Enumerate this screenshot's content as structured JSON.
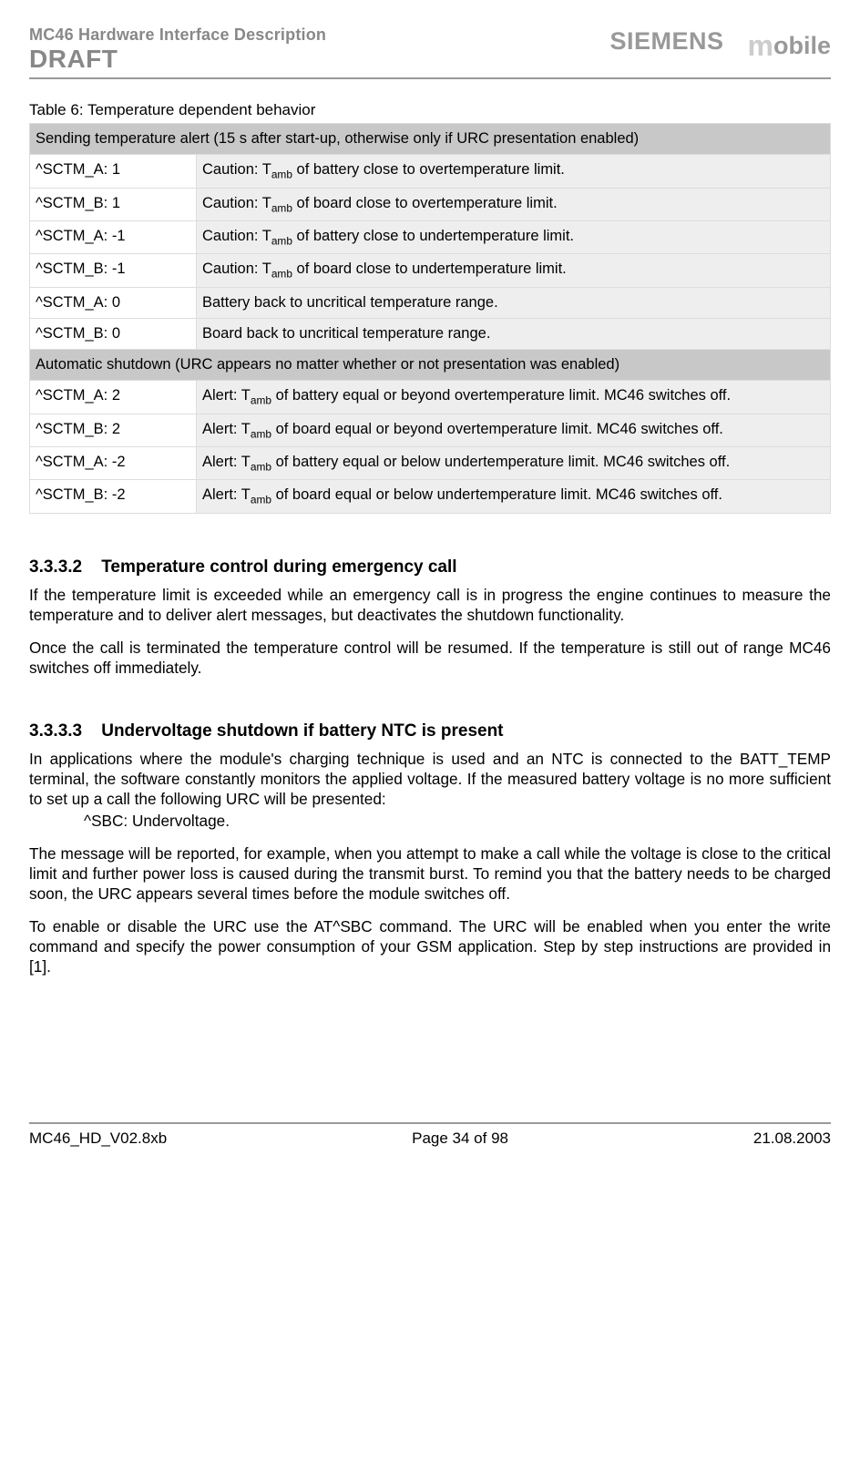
{
  "header": {
    "doc_title": "MC46 Hardware Interface Description",
    "draft": "DRAFT",
    "siemens": "SIEMENS",
    "mobile_accent": "m",
    "mobile_rest": "obile"
  },
  "table": {
    "caption": "Table 6: Temperature dependent behavior",
    "section1": "Sending temperature alert (15 s after  start-up, otherwise only if URC presentation enabled)",
    "section2": "Automatic shutdown (URC appears no matter whether or not presentation was enabled)",
    "rows1": [
      {
        "l": "^SCTM_A:  1",
        "r_pre": "Caution: T",
        "r_sub": "amb",
        "r_post": " of battery close to overtemperature limit."
      },
      {
        "l": "^SCTM_B:  1",
        "r_pre": "Caution: T",
        "r_sub": "amb",
        "r_post": " of board close to overtemperature limit."
      },
      {
        "l": "^SCTM_A:  -1",
        "r_pre": "Caution: T",
        "r_sub": "amb",
        "r_post": " of battery close to undertemperature limit."
      },
      {
        "l": "^SCTM_B:  -1",
        "r_pre": "Caution: T",
        "r_sub": "amb",
        "r_post": " of board close to undertemperature limit."
      },
      {
        "l": "^SCTM_A: 0",
        "r_pre": "Battery back to uncritical temperature range.",
        "r_sub": "",
        "r_post": ""
      },
      {
        "l": "^SCTM_B: 0",
        "r_pre": "Board back to uncritical temperature range.",
        "r_sub": "",
        "r_post": ""
      }
    ],
    "rows2": [
      {
        "l": "^SCTM_A:  2",
        "r_pre": "Alert: T",
        "r_sub": "amb",
        "r_post": " of battery equal or beyond overtemperature limit. MC46 switches off."
      },
      {
        "l": "^SCTM_B:  2",
        "r_pre": "Alert: T",
        "r_sub": "amb",
        "r_post": " of board equal or beyond overtemperature limit. MC46 switches off."
      },
      {
        "l": "^SCTM_A:  -2",
        "r_pre": "Alert: T",
        "r_sub": "amb",
        "r_post": " of battery equal or below undertemperature limit. MC46 switches off."
      },
      {
        "l": "^SCTM_B:  -2",
        "r_pre": "Alert: T",
        "r_sub": "amb",
        "r_post": " of board equal or below undertemperature limit. MC46 switches off."
      }
    ]
  },
  "sec_3332": {
    "heading_num": "3.3.3.2",
    "heading_text": "Temperature control during emergency call",
    "p1": "If the temperature limit is exceeded while an emergency call is in progress the engine continues to measure the temperature and to deliver alert messages, but deactivates the shutdown functionality.",
    "p2": "Once the call is terminated the temperature control will be resumed. If the temperature is still out of range MC46 switches off immediately."
  },
  "sec_3333": {
    "heading_num": "3.3.3.3",
    "heading_text": "Undervoltage shutdown if battery NTC is present",
    "p1": "In applications where the module's charging technique is used and an NTC is connected to the BATT_TEMP terminal, the software constantly monitors the applied voltage. If the measured battery voltage is no more sufficient to set up a call the following URC will be presented:",
    "urc": "^SBC:  Undervoltage.",
    "p2": "The message will be reported, for example, when you attempt to make a call while the voltage is close to the critical limit and further power loss is caused during the transmit burst. To remind you that the battery needs to be charged soon, the URC appears several times before the module switches off.",
    "p3": "To enable or disable the URC use the AT^SBC command. The URC will be enabled when you enter the write command and specify the power consumption of your GSM application. Step by step instructions are provided in [1]."
  },
  "footer": {
    "left": "MC46_HD_V02.8xb",
    "center": "Page 34 of 98",
    "right": "21.08.2003"
  }
}
